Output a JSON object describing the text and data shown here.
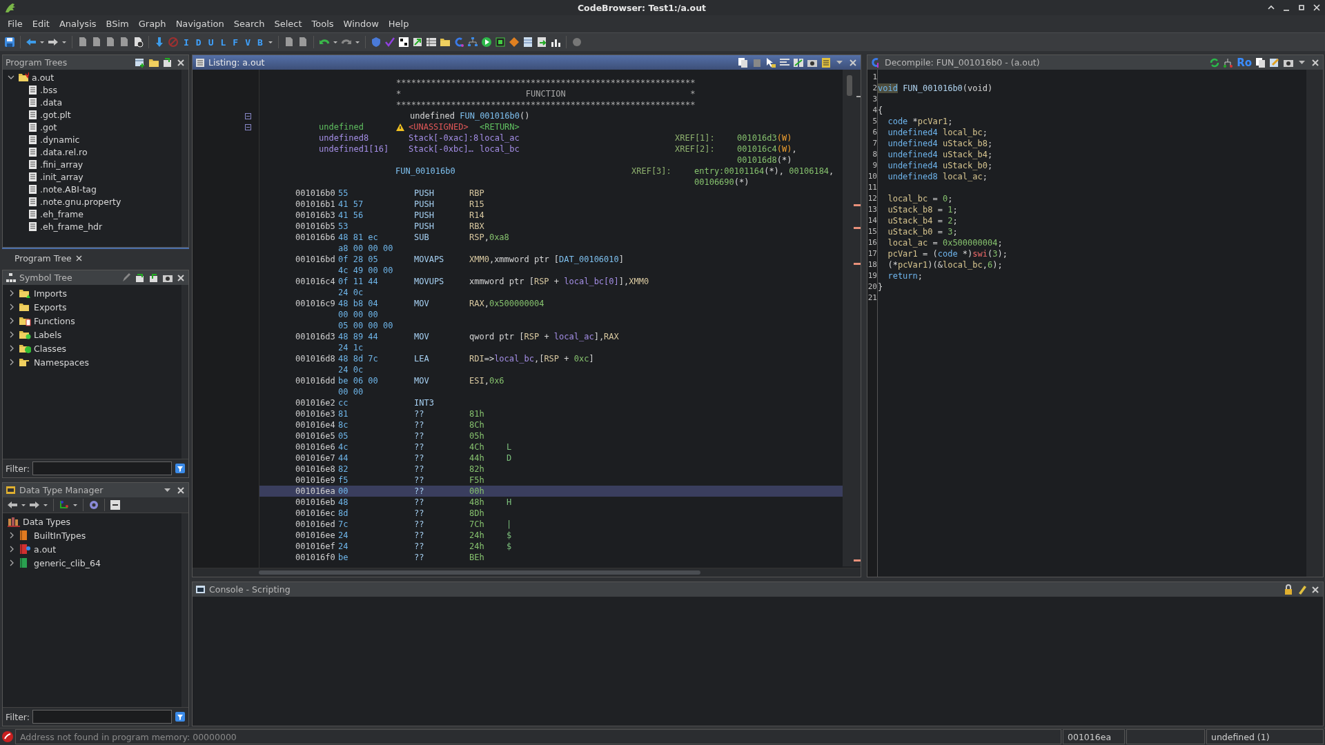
{
  "window": {
    "title": "CodeBrowser: Test1:/a.out"
  },
  "menu": [
    "File",
    "Edit",
    "Analysis",
    "BSim",
    "Graph",
    "Navigation",
    "Search",
    "Select",
    "Tools",
    "Window",
    "Help"
  ],
  "toolbar": {
    "letters": [
      "I",
      "D",
      "U",
      "L",
      "F",
      "V",
      "B"
    ]
  },
  "program_trees": {
    "title": "Program Trees",
    "tab": "Program Tree",
    "root": {
      "label": "a.out",
      "expanded": true,
      "children": [
        {
          "label": ".bss"
        },
        {
          "label": ".data"
        },
        {
          "label": ".got.plt"
        },
        {
          "label": ".got"
        },
        {
          "label": ".dynamic"
        },
        {
          "label": ".data.rel.ro"
        },
        {
          "label": ".fini_array"
        },
        {
          "label": ".init_array"
        },
        {
          "label": ".note.ABI-tag"
        },
        {
          "label": ".note.gnu.property"
        },
        {
          "label": ".eh_frame"
        },
        {
          "label": ".eh_frame_hdr"
        }
      ]
    }
  },
  "symbol_tree": {
    "title": "Symbol Tree",
    "filter_label": "Filter:",
    "items": [
      {
        "label": "Imports",
        "kind": "imports",
        "expanded": false
      },
      {
        "label": "Exports",
        "kind": "exports",
        "expanded": false
      },
      {
        "label": "Functions",
        "kind": "functions",
        "expanded": false
      },
      {
        "label": "Labels",
        "kind": "labels",
        "expanded": false
      },
      {
        "label": "Classes",
        "kind": "classes",
        "expanded": false
      },
      {
        "label": "Namespaces",
        "kind": "namespaces",
        "expanded": false
      }
    ]
  },
  "data_type_manager": {
    "title": "Data Type Manager",
    "filter_label": "Filter:",
    "root": {
      "label": "Data Types",
      "children": [
        {
          "label": "BuiltInTypes",
          "kind": "builtin",
          "expanded": false
        },
        {
          "label": "a.out",
          "kind": "program",
          "expanded": false
        },
        {
          "label": "generic_clib_64",
          "kind": "archive",
          "expanded": false
        }
      ]
    }
  },
  "listing": {
    "title": "Listing:  a.out",
    "plate": [
      "************************************************************",
      "*                         FUNCTION                         *",
      "************************************************************"
    ],
    "signature": [
      {
        "text": "undefined ",
        "kind": "plain"
      },
      {
        "text": "FUN_001016b0",
        "kind": "label"
      },
      {
        "text": "()",
        "kind": "plain"
      }
    ],
    "variables": [
      {
        "kind": "return",
        "type": "undefined",
        "warning": true,
        "storage": "<UNASSIGNED>",
        "name": "<RETURN>"
      },
      {
        "kind": "local",
        "type": "undefined8",
        "warning": false,
        "storage": "Stack[-0xac]:8",
        "name": "local_ac",
        "xref_label": "XREF[1]:",
        "xrefs": [
          [
            {
              "text": "001016d3",
              "kind": "num"
            },
            {
              "text": "(W)",
              "kind": "write"
            }
          ]
        ]
      },
      {
        "kind": "local",
        "type": "undefined1[16]",
        "warning": false,
        "storage": "Stack[-0xbc]…",
        "name": "local_bc",
        "xref_label": "XREF[2]:",
        "xrefs": [
          [
            {
              "text": "001016c4",
              "kind": "num"
            },
            {
              "text": "(W)",
              "kind": "write"
            },
            {
              "text": ",",
              "kind": "plain"
            }
          ],
          [
            {
              "text": "001016d8",
              "kind": "num"
            },
            {
              "text": "(*)",
              "kind": "plain"
            }
          ]
        ]
      }
    ],
    "label": {
      "name": "FUN_001016b0",
      "xref_label": "XREF[3]:",
      "xrefs": [
        [
          {
            "text": "entry:00101164",
            "kind": "num"
          },
          {
            "text": "(*), ",
            "kind": "plain"
          },
          {
            "text": "00106184",
            "kind": "num"
          },
          {
            "text": ",",
            "kind": "plain"
          }
        ],
        [
          {
            "text": "00106690",
            "kind": "num"
          },
          {
            "text": "(*)",
            "kind": "plain"
          }
        ]
      ]
    },
    "rows": [
      {
        "address": "001016b0",
        "bytes": [
          "55"
        ],
        "mnemonic": "PUSH",
        "operands": [
          {
            "text": "RBP",
            "kind": "reg"
          }
        ],
        "selected": false
      },
      {
        "address": "001016b1",
        "bytes": [
          "41 57"
        ],
        "mnemonic": "PUSH",
        "operands": [
          {
            "text": "R15",
            "kind": "reg"
          }
        ],
        "selected": false
      },
      {
        "address": "001016b3",
        "bytes": [
          "41 56"
        ],
        "mnemonic": "PUSH",
        "operands": [
          {
            "text": "R14",
            "kind": "reg"
          }
        ],
        "selected": false
      },
      {
        "address": "001016b5",
        "bytes": [
          "53"
        ],
        "mnemonic": "PUSH",
        "operands": [
          {
            "text": "RBX",
            "kind": "reg"
          }
        ],
        "selected": false
      },
      {
        "address": "001016b6",
        "bytes": [
          "48 81 ec",
          "a8 00 00 00"
        ],
        "mnemonic": "SUB",
        "operands": [
          {
            "text": "RSP",
            "kind": "reg"
          },
          {
            "text": ",",
            "kind": "plain"
          },
          {
            "text": "0xa8",
            "kind": "num"
          }
        ],
        "selected": false
      },
      {
        "address": "001016bd",
        "bytes": [
          "0f 28 05",
          "4c 49 00 00"
        ],
        "mnemonic": "MOVAPS",
        "operands": [
          {
            "text": "XMM0",
            "kind": "reg"
          },
          {
            "text": ",xmmword ptr [",
            "kind": "plain"
          },
          {
            "text": "DAT_00106010",
            "kind": "label"
          },
          {
            "text": "]",
            "kind": "plain"
          }
        ],
        "selected": false
      },
      {
        "address": "001016c4",
        "bytes": [
          "0f 11 44",
          "24 0c"
        ],
        "mnemonic": "MOVUPS",
        "operands": [
          {
            "text": "xmmword ptr [",
            "kind": "plain"
          },
          {
            "text": "RSP",
            "kind": "reg"
          },
          {
            "text": " + ",
            "kind": "plain"
          },
          {
            "text": "local_bc[0]",
            "kind": "var"
          },
          {
            "text": "],",
            "kind": "plain"
          },
          {
            "text": "XMM0",
            "kind": "reg"
          }
        ],
        "selected": false
      },
      {
        "address": "001016c9",
        "bytes": [
          "48 b8 04",
          "00 00 00",
          "05 00 00 00"
        ],
        "mnemonic": "MOV",
        "operands": [
          {
            "text": "RAX",
            "kind": "reg"
          },
          {
            "text": ",",
            "kind": "plain"
          },
          {
            "text": "0x500000004",
            "kind": "num"
          }
        ],
        "selected": false
      },
      {
        "address": "001016d3",
        "bytes": [
          "48 89 44",
          "24 1c"
        ],
        "mnemonic": "MOV",
        "operands": [
          {
            "text": "qword ptr [",
            "kind": "plain"
          },
          {
            "text": "RSP",
            "kind": "reg"
          },
          {
            "text": " + ",
            "kind": "plain"
          },
          {
            "text": "local_ac",
            "kind": "var"
          },
          {
            "text": "],",
            "kind": "plain"
          },
          {
            "text": "RAX",
            "kind": "reg"
          }
        ],
        "selected": false
      },
      {
        "address": "001016d8",
        "bytes": [
          "48 8d 7c",
          "24 0c"
        ],
        "mnemonic": "LEA",
        "operands": [
          {
            "text": "RDI",
            "kind": "reg"
          },
          {
            "text": "=>",
            "kind": "plain"
          },
          {
            "text": "local_bc",
            "kind": "var"
          },
          {
            "text": ",[",
            "kind": "plain"
          },
          {
            "text": "RSP",
            "kind": "reg"
          },
          {
            "text": " + ",
            "kind": "plain"
          },
          {
            "text": "0xc",
            "kind": "num"
          },
          {
            "text": "]",
            "kind": "plain"
          }
        ],
        "selected": false
      },
      {
        "address": "001016dd",
        "bytes": [
          "be 06 00",
          "00 00"
        ],
        "mnemonic": "MOV",
        "operands": [
          {
            "text": "ESI",
            "kind": "reg"
          },
          {
            "text": ",",
            "kind": "plain"
          },
          {
            "text": "0x6",
            "kind": "num"
          }
        ],
        "selected": false
      },
      {
        "address": "001016e2",
        "bytes": [
          "cc"
        ],
        "mnemonic": "INT3",
        "selected": false
      },
      {
        "address": "001016e3",
        "bytes": [
          "81"
        ],
        "mnemonic": "??",
        "operands": [
          {
            "text": "81h",
            "kind": "num"
          }
        ],
        "selected": false
      },
      {
        "address": "001016e4",
        "bytes": [
          "8c"
        ],
        "mnemonic": "??",
        "operands": [
          {
            "text": "8Ch",
            "kind": "num"
          }
        ],
        "selected": false
      },
      {
        "address": "001016e5",
        "bytes": [
          "05"
        ],
        "mnemonic": "??",
        "operands": [
          {
            "text": "05h",
            "kind": "num"
          }
        ],
        "selected": false
      },
      {
        "address": "001016e6",
        "bytes": [
          "4c"
        ],
        "mnemonic": "??",
        "operands": [
          {
            "text": "4Ch",
            "kind": "num"
          }
        ],
        "ascii": "L",
        "selected": false
      },
      {
        "address": "001016e7",
        "bytes": [
          "44"
        ],
        "mnemonic": "??",
        "operands": [
          {
            "text": "44h",
            "kind": "num"
          }
        ],
        "ascii": "D",
        "selected": false
      },
      {
        "address": "001016e8",
        "bytes": [
          "82"
        ],
        "mnemonic": "??",
        "operands": [
          {
            "text": "82h",
            "kind": "num"
          }
        ],
        "selected": false
      },
      {
        "address": "001016e9",
        "bytes": [
          "f5"
        ],
        "mnemonic": "??",
        "operands": [
          {
            "text": "F5h",
            "kind": "num"
          }
        ],
        "selected": false
      },
      {
        "address": "001016ea",
        "bytes": [
          "00"
        ],
        "mnemonic": "??",
        "operands": [
          {
            "text": "00h",
            "kind": "num"
          }
        ],
        "selected": true
      },
      {
        "address": "001016eb",
        "bytes": [
          "48"
        ],
        "mnemonic": "??",
        "operands": [
          {
            "text": "48h",
            "kind": "num"
          }
        ],
        "ascii": "H",
        "selected": false
      },
      {
        "address": "001016ec",
        "bytes": [
          "8d"
        ],
        "mnemonic": "??",
        "operands": [
          {
            "text": "8Dh",
            "kind": "num"
          }
        ],
        "selected": false
      },
      {
        "address": "001016ed",
        "bytes": [
          "7c"
        ],
        "mnemonic": "??",
        "operands": [
          {
            "text": "7Ch",
            "kind": "num"
          }
        ],
        "ascii": "|",
        "selected": false
      },
      {
        "address": "001016ee",
        "bytes": [
          "24"
        ],
        "mnemonic": "??",
        "operands": [
          {
            "text": "24h",
            "kind": "num"
          }
        ],
        "ascii": "$",
        "selected": false
      },
      {
        "address": "001016ef",
        "bytes": [
          "24"
        ],
        "mnemonic": "??",
        "operands": [
          {
            "text": "24h",
            "kind": "num"
          }
        ],
        "ascii": "$",
        "selected": false
      },
      {
        "address": "001016f0",
        "bytes": [
          "be"
        ],
        "mnemonic": "??",
        "operands": [
          {
            "text": "BEh",
            "kind": "num"
          }
        ],
        "selected": false
      }
    ]
  },
  "decompile": {
    "title": "Decompile: FUN_001016b0 -  (a.out)",
    "ro": "Ro",
    "lines": [
      {
        "number": "1"
      },
      {
        "number": "2",
        "segments": [
          {
            "text": "void",
            "kind": "type",
            "selected": true
          },
          {
            "text": " FUN_001016b0",
            "kind": "fn"
          },
          {
            "text": "(void)",
            "kind": "plain"
          }
        ]
      },
      {
        "number": "3"
      },
      {
        "number": "4",
        "segments": [
          {
            "text": "{",
            "kind": "plain"
          }
        ]
      },
      {
        "number": "5",
        "segments": [
          {
            "text": "  code",
            "kind": "type"
          },
          {
            "text": " *",
            "kind": "plain"
          },
          {
            "text": "pcVar1",
            "kind": "var"
          },
          {
            "text": ";",
            "kind": "plain"
          }
        ]
      },
      {
        "number": "6",
        "segments": [
          {
            "text": "  undefined4 ",
            "kind": "type"
          },
          {
            "text": "local_bc",
            "kind": "var"
          },
          {
            "text": ";",
            "kind": "plain"
          }
        ]
      },
      {
        "number": "7",
        "segments": [
          {
            "text": "  undefined4 ",
            "kind": "type"
          },
          {
            "text": "uStack_b8",
            "kind": "var"
          },
          {
            "text": ";",
            "kind": "plain"
          }
        ]
      },
      {
        "number": "8",
        "segments": [
          {
            "text": "  undefined4 ",
            "kind": "type"
          },
          {
            "text": "uStack_b4",
            "kind": "var"
          },
          {
            "text": ";",
            "kind": "plain"
          }
        ]
      },
      {
        "number": "9",
        "segments": [
          {
            "text": "  undefined4 ",
            "kind": "type"
          },
          {
            "text": "uStack_b0",
            "kind": "var"
          },
          {
            "text": ";",
            "kind": "plain"
          }
        ]
      },
      {
        "number": "10",
        "segments": [
          {
            "text": "  undefined8 ",
            "kind": "type"
          },
          {
            "text": "local_ac",
            "kind": "var"
          },
          {
            "text": ";",
            "kind": "plain"
          }
        ]
      },
      {
        "number": "11"
      },
      {
        "number": "12",
        "segments": [
          {
            "text": "  local_bc",
            "kind": "var"
          },
          {
            "text": " = ",
            "kind": "plain"
          },
          {
            "text": "0",
            "kind": "num"
          },
          {
            "text": ";",
            "kind": "plain"
          }
        ]
      },
      {
        "number": "13",
        "segments": [
          {
            "text": "  uStack_b8",
            "kind": "var"
          },
          {
            "text": " = ",
            "kind": "plain"
          },
          {
            "text": "1",
            "kind": "num"
          },
          {
            "text": ";",
            "kind": "plain"
          }
        ]
      },
      {
        "number": "14",
        "segments": [
          {
            "text": "  uStack_b4",
            "kind": "var"
          },
          {
            "text": " = ",
            "kind": "plain"
          },
          {
            "text": "2",
            "kind": "num"
          },
          {
            "text": ";",
            "kind": "plain"
          }
        ]
      },
      {
        "number": "15",
        "segments": [
          {
            "text": "  uStack_b0",
            "kind": "var"
          },
          {
            "text": " = ",
            "kind": "plain"
          },
          {
            "text": "3",
            "kind": "num"
          },
          {
            "text": ";",
            "kind": "plain"
          }
        ]
      },
      {
        "number": "16",
        "segments": [
          {
            "text": "  local_ac",
            "kind": "var"
          },
          {
            "text": " = ",
            "kind": "plain"
          },
          {
            "text": "0x500000004",
            "kind": "num"
          },
          {
            "text": ";",
            "kind": "plain"
          }
        ]
      },
      {
        "number": "17",
        "segments": [
          {
            "text": "  pcVar1",
            "kind": "var"
          },
          {
            "text": " = (",
            "kind": "plain"
          },
          {
            "text": "code",
            "kind": "type"
          },
          {
            "text": " *)",
            "kind": "plain"
          },
          {
            "text": "swi",
            "kind": "call"
          },
          {
            "text": "(",
            "kind": "plain"
          },
          {
            "text": "3",
            "kind": "num"
          },
          {
            "text": ");",
            "kind": "plain"
          }
        ]
      },
      {
        "number": "18",
        "segments": [
          {
            "text": "  (*",
            "kind": "plain"
          },
          {
            "text": "pcVar1",
            "kind": "var"
          },
          {
            "text": ")(&",
            "kind": "plain"
          },
          {
            "text": "local_bc",
            "kind": "var"
          },
          {
            "text": ",",
            "kind": "plain"
          },
          {
            "text": "6",
            "kind": "num"
          },
          {
            "text": ");",
            "kind": "plain"
          }
        ]
      },
      {
        "number": "19",
        "segments": [
          {
            "text": "  return",
            "kind": "type"
          },
          {
            "text": ";",
            "kind": "plain"
          }
        ]
      },
      {
        "number": "20",
        "segments": [
          {
            "text": "}",
            "kind": "plain"
          }
        ]
      },
      {
        "number": "21"
      }
    ]
  },
  "console": {
    "title": "Console - Scripting"
  },
  "status_bar": {
    "message": "Address not found in program memory: 00000000",
    "address": "001016ea",
    "info": "undefined (1)"
  }
}
